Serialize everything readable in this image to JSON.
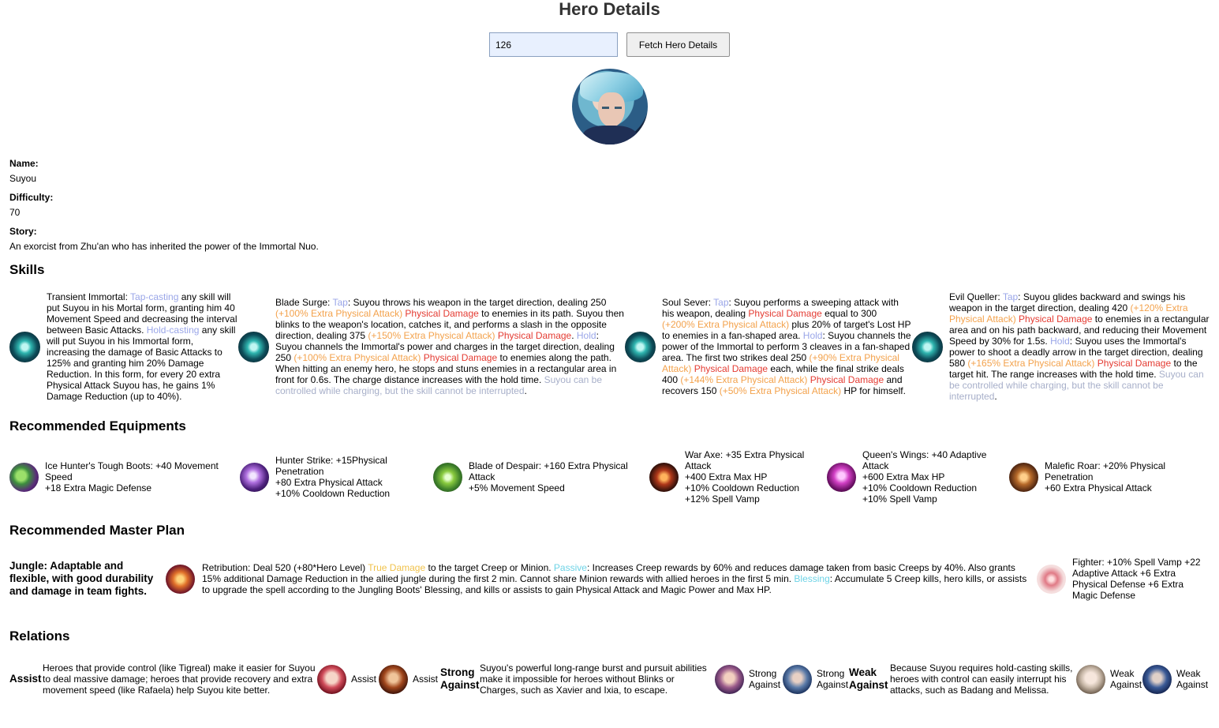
{
  "header": {
    "title": "Hero Details"
  },
  "search": {
    "value": "126",
    "button_label": "Fetch Hero Details"
  },
  "hero": {
    "name_label": "Name:",
    "name": "Suyou",
    "difficulty_label": "Difficulty:",
    "difficulty": "70",
    "story_label": "Story:",
    "story": "An exorcist from Zhu'an who has inherited the power of the Immortal Nuo."
  },
  "skills_title": "Skills",
  "skills": [
    {
      "icon": "transient-immortal-icon",
      "parts": [
        {
          "t": "Transient Immortal: ",
          "c": ""
        },
        {
          "t": "Tap-casting",
          "c": "tap"
        },
        {
          "t": " any skill will put Suyou in his Mortal form, granting him 40 Movement Speed and decreasing the interval between Basic Attacks. ",
          "c": ""
        },
        {
          "t": "Hold-casting",
          "c": "tap"
        },
        {
          "t": " any skill will put Suyou in his Immortal form, increasing the damage of Basic Attacks to 125% and granting him 20% Damage Reduction. In this form, for every 20 extra Physical Attack Suyou has, he gains 1% Damage Reduction (up to 40%).",
          "c": ""
        }
      ]
    },
    {
      "icon": "blade-surge-icon",
      "parts": [
        {
          "t": "Blade Surge: ",
          "c": ""
        },
        {
          "t": "Tap",
          "c": "tap"
        },
        {
          "t": ": Suyou throws his weapon in the target direction, dealing 250 ",
          "c": ""
        },
        {
          "t": "(+100% Extra Physical Attack)",
          "c": "orange"
        },
        {
          "t": " ",
          "c": ""
        },
        {
          "t": "Physical Damage",
          "c": "red"
        },
        {
          "t": " to enemies in its path. Suyou then blinks to the weapon's location, catches it, and performs a slash in the opposite direction, dealing 375 ",
          "c": ""
        },
        {
          "t": "(+150% Extra Physical Attack)",
          "c": "orange"
        },
        {
          "t": " ",
          "c": ""
        },
        {
          "t": "Physical Damage",
          "c": "red"
        },
        {
          "t": ". ",
          "c": ""
        },
        {
          "t": "Hold",
          "c": "tap"
        },
        {
          "t": ": Suyou channels the Immortal's power and charges in the target direction, dealing 250 ",
          "c": ""
        },
        {
          "t": "(+100% Extra Physical Attack)",
          "c": "orange"
        },
        {
          "t": " ",
          "c": ""
        },
        {
          "t": "Physical Damage",
          "c": "red"
        },
        {
          "t": " to enemies along the path. When hitting an enemy hero, he stops and stuns enemies in a rectangular area in front for 0.6s. The charge distance increases with the hold time. ",
          "c": ""
        },
        {
          "t": "Suyou can be controlled while charging, but the skill cannot be interrupted",
          "c": "grey"
        },
        {
          "t": ".",
          "c": ""
        }
      ]
    },
    {
      "icon": "soul-sever-icon",
      "parts": [
        {
          "t": "Soul Sever: ",
          "c": ""
        },
        {
          "t": "Tap",
          "c": "tap"
        },
        {
          "t": ": Suyou performs a sweeping attack with his weapon, dealing ",
          "c": ""
        },
        {
          "t": "Physical Damage",
          "c": "red"
        },
        {
          "t": " equal to 300 ",
          "c": ""
        },
        {
          "t": "(+200% Extra Physical Attack)",
          "c": "orange"
        },
        {
          "t": " plus 20% of target's Lost HP to enemies in a fan-shaped area. ",
          "c": ""
        },
        {
          "t": "Hold",
          "c": "tap"
        },
        {
          "t": ": Suyou channels the power of the Immortal to perform 3 cleaves in a fan-shaped area. The first two strikes deal 250 ",
          "c": ""
        },
        {
          "t": "(+90% Extra Physical Attack)",
          "c": "orange"
        },
        {
          "t": " ",
          "c": ""
        },
        {
          "t": "Physical Damage",
          "c": "red"
        },
        {
          "t": " each, while the final strike deals 400 ",
          "c": ""
        },
        {
          "t": "(+144% Extra Physical Attack)",
          "c": "orange"
        },
        {
          "t": " ",
          "c": ""
        },
        {
          "t": "Physical Damage",
          "c": "red"
        },
        {
          "t": " and recovers 150 ",
          "c": ""
        },
        {
          "t": "(+50% Extra Physical Attack)",
          "c": "orange"
        },
        {
          "t": " HP for himself.",
          "c": ""
        }
      ]
    },
    {
      "icon": "evil-queller-icon",
      "parts": [
        {
          "t": "Evil Queller: ",
          "c": ""
        },
        {
          "t": "Tap",
          "c": "tap"
        },
        {
          "t": ": Suyou glides backward and swings his weapon in the target direction, dealing 420 ",
          "c": ""
        },
        {
          "t": "(+120% Extra Physical Attack)",
          "c": "orange"
        },
        {
          "t": " ",
          "c": ""
        },
        {
          "t": "Physical Damage",
          "c": "red"
        },
        {
          "t": " to enemies in a rectangular area and on his path backward, and reducing their Movement Speed by 30% for 1.5s. ",
          "c": ""
        },
        {
          "t": "Hold",
          "c": "tap"
        },
        {
          "t": ": Suyou uses the Immortal's power to shoot a deadly arrow in the target direction, dealing 580 ",
          "c": ""
        },
        {
          "t": "(+165% Extra Physical Attack)",
          "c": "orange"
        },
        {
          "t": " ",
          "c": ""
        },
        {
          "t": "Physical Damage",
          "c": "red"
        },
        {
          "t": " to the target hit. The range increases with the hold time. ",
          "c": ""
        },
        {
          "t": "Suyou can be controlled while charging, but the skill cannot be interrupted",
          "c": "grey"
        },
        {
          "t": ".",
          "c": ""
        }
      ]
    }
  ],
  "equipments_title": "Recommended Equipments",
  "equipments": [
    {
      "icon": "boots-icon",
      "lines": [
        "Ice Hunter's Tough Boots: +40 Movement Speed",
        "+18 Extra Magic Defense"
      ]
    },
    {
      "icon": "hunter-strike-icon",
      "lines": [
        "Hunter Strike: +15Physical Penetration",
        "+80 Extra Physical Attack",
        "+10% Cooldown Reduction"
      ]
    },
    {
      "icon": "blade-of-despair-icon",
      "lines": [
        "Blade of Despair: +160 Extra Physical Attack",
        "+5% Movement Speed"
      ]
    },
    {
      "icon": "war-axe-icon",
      "lines": [
        "War Axe: +35 Extra Physical Attack",
        "+400 Extra Max HP",
        "+10% Cooldown Reduction",
        "+12% Spell Vamp"
      ]
    },
    {
      "icon": "queens-wings-icon",
      "lines": [
        "Queen's Wings: +40 Adaptive Attack",
        "+600 Extra Max HP",
        "+10% Cooldown Reduction",
        "+10% Spell Vamp"
      ]
    },
    {
      "icon": "malefic-roar-icon",
      "lines": [
        "Malefic Roar: +20% Physical Penetration",
        "+60 Extra Physical Attack"
      ]
    }
  ],
  "master_plan_title": "Recommended Master Plan",
  "master_plan": {
    "name": "Jungle: Adaptable and flexible, with good durability and damage in team fights.",
    "spell_icon": "retribution-icon",
    "spell_parts": [
      {
        "t": "Retribution: Deal 520 (+80*Hero Level) ",
        "c": ""
      },
      {
        "t": "True Damage",
        "c": "gold"
      },
      {
        "t": " to the target Creep or Minion. ",
        "c": ""
      },
      {
        "t": "Passive",
        "c": "cyan"
      },
      {
        "t": ": Increases Creep rewards by 60% and reduces damage taken from basic Creeps by 40%. Also grants 15% additional Damage Reduction in the allied jungle during the first 2 min. Cannot share Minion rewards with allied heroes in the first 5 min. ",
        "c": ""
      },
      {
        "t": "Blessing",
        "c": "cyan"
      },
      {
        "t": ": Accumulate 5 Creep kills, hero kills, or assists to upgrade the spell according to the Jungling Boots' Blessing, and kills or assists to gain Physical Attack and Magic Power and Max HP.",
        "c": ""
      }
    ],
    "emblem_icon": "fighter-emblem-icon",
    "emblem_text": "Fighter: +10% Spell Vamp +22 Adaptive Attack +6 Extra Physical Defense +6 Extra Magic Defense"
  },
  "relations_title": "Relations",
  "relations": {
    "assist": {
      "type": "Assist",
      "desc": "Heroes that provide control (like Tigreal) make it easier for Suyou to deal massive damage; heroes that provide recovery and extra movement speed (like Rafaela) help Suyou kite better.",
      "heroes": [
        {
          "icon": "assist-hero-1-icon",
          "label": "Assist"
        },
        {
          "icon": "assist-hero-2-icon",
          "label": "Assist"
        }
      ]
    },
    "strong": {
      "type": "Strong Against",
      "desc": "Suyou's powerful long-range burst and pursuit abilities make it impossible for heroes without Blinks or Charges, such as Xavier and Ixia, to escape.",
      "heroes": [
        {
          "icon": "strong-hero-1-icon",
          "label": "Strong Against"
        },
        {
          "icon": "strong-hero-2-icon",
          "label": "Strong Against"
        }
      ]
    },
    "weak": {
      "type": "Weak Against",
      "desc": "Because Suyou requires hold-casting skills, heroes with control can easily interrupt his attacks, such as Badang and Melissa.",
      "heroes": [
        {
          "icon": "weak-hero-1-icon",
          "label": "Weak Against"
        },
        {
          "icon": "weak-hero-2-icon",
          "label": "Weak Against"
        }
      ]
    }
  }
}
